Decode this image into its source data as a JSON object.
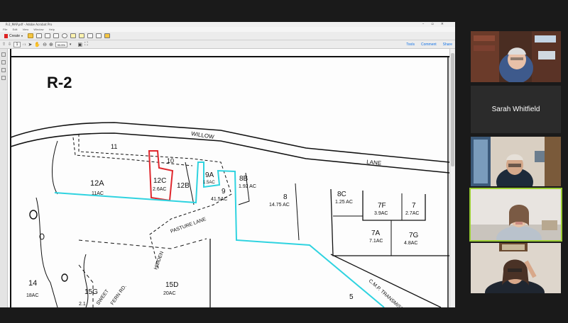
{
  "acrobat": {
    "window_title": "R-2_MAP.pdf - Adobe Acrobat Pro",
    "menu": [
      "File",
      "Edit",
      "View",
      "Window",
      "Help"
    ],
    "create_label": "Create",
    "page_current": "1",
    "page_total": "/ 1",
    "zoom": "93.5%",
    "right_links": [
      "Tools",
      "Comment",
      "Share"
    ]
  },
  "map": {
    "zone": "R-2",
    "roads": [
      "WILLOW",
      "LANE",
      "PASTURE LANE",
      "HIDDEN",
      "SWEET",
      "FERN RD.",
      "C.M.P. TRANSMISSION"
    ],
    "lots": [
      {
        "id": "11",
        "area": ""
      },
      {
        "id": "10",
        "area": ""
      },
      {
        "id": "12A",
        "area": "11AC"
      },
      {
        "id": "12C",
        "area": "2.6AC"
      },
      {
        "id": "12B",
        "area": ""
      },
      {
        "id": "9A",
        "area": "1.5AC"
      },
      {
        "id": "9",
        "area": "41.5AC"
      },
      {
        "id": "8B",
        "area": "1.92 AC"
      },
      {
        "id": "8",
        "area": "14.75 AC"
      },
      {
        "id": "8C",
        "area": "1.25 AC"
      },
      {
        "id": "7F",
        "area": "3.9AC"
      },
      {
        "id": "7",
        "area": "2.7AC"
      },
      {
        "id": "7A",
        "area": "7.1AC"
      },
      {
        "id": "7G",
        "area": "4.8AC"
      },
      {
        "id": "14",
        "area": "18AC"
      },
      {
        "id": "15D",
        "area": "20AC"
      },
      {
        "id": "15G",
        "area": "2.1"
      },
      {
        "id": "5",
        "area": ""
      }
    ],
    "colors": {
      "highlight_red": "#e0282e",
      "highlight_cyan": "#2fd3e0",
      "line": "#111111"
    }
  },
  "participants": [
    {
      "name": "",
      "video": true
    },
    {
      "name": "Sarah Whitfield",
      "video": false
    },
    {
      "name": "",
      "video": true
    },
    {
      "name": "",
      "video": true,
      "speaking": true
    },
    {
      "name": "",
      "video": true
    }
  ],
  "nav": {
    "up_icon": "chevron-up-icon",
    "down_icon": "chevron-down-icon"
  }
}
